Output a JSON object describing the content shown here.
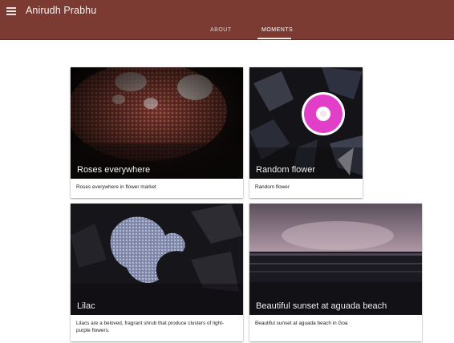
{
  "app": {
    "title": "Anirudh Prabhu"
  },
  "tabs": [
    {
      "label": "ABOUT"
    },
    {
      "label": "MOMENTS"
    }
  ],
  "cards": [
    {
      "title": "Roses everywhere",
      "description": "Roses everywhere in flower market"
    },
    {
      "title": "Random flower",
      "description": "Random flower"
    },
    {
      "title": "Lilac",
      "description": "Lilacs are a beloved, fragrant shrub that produce clusters of light-purple flowers."
    },
    {
      "title": "Beautiful sunset at aguada beach",
      "description": "Beautiful sunset at aguada beach in Goa"
    }
  ],
  "colors": {
    "appbar": "#7b3b33",
    "accent_pink": "#e23fc8"
  }
}
